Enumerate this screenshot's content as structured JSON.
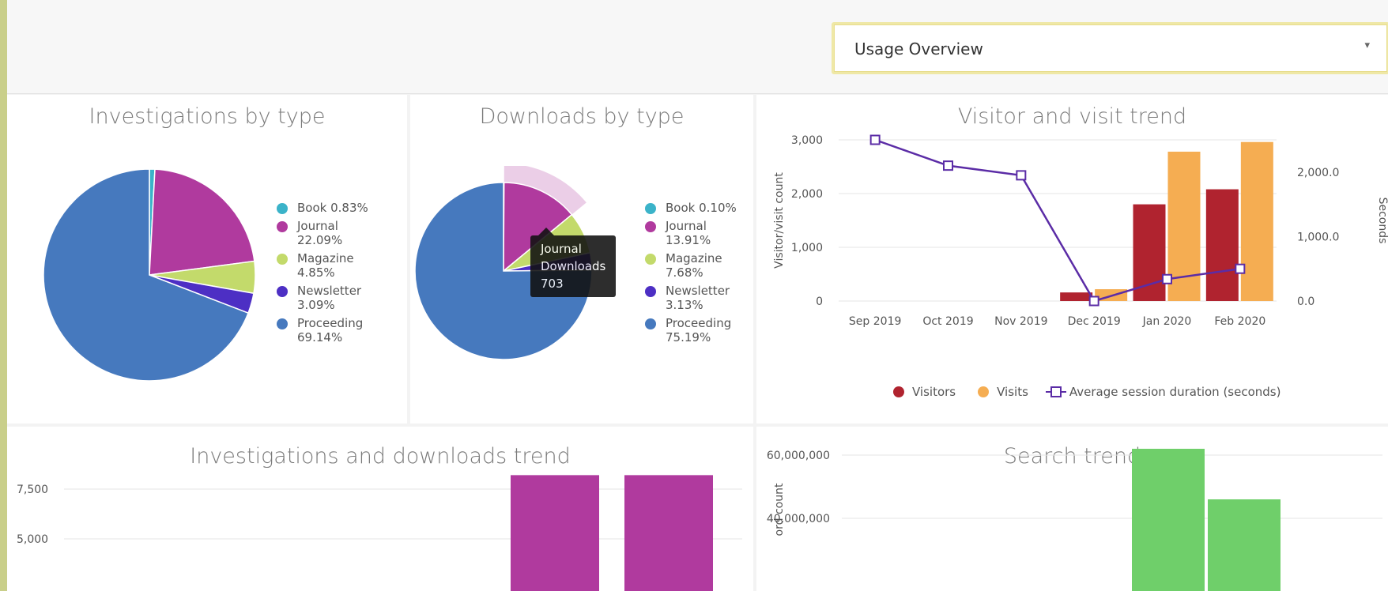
{
  "header": {
    "dropdown_value": "Usage Overview",
    "caret": "▾"
  },
  "charts": {
    "investigations_by_type": {
      "title": "Investigations by type"
    },
    "downloads_by_type": {
      "title": "Downloads by type"
    },
    "visitor_trend": {
      "title": "Visitor and visit trend",
      "ylabel_left": "Visitor/visit count",
      "ylabel_right": "Seconds"
    },
    "inv_dl_trend": {
      "title": "Investigations and downloads trend"
    },
    "search_trend": {
      "title": "Search trend",
      "ylabel": "ord count"
    }
  },
  "tooltip": {
    "line1": "Journal",
    "line2": "Downloads",
    "line3": "703"
  },
  "colors": {
    "book": "#3bb3c9",
    "journal": "#b03a9e",
    "magazine": "#c3da6b",
    "newsletter": "#4d2fc4",
    "proceeding": "#4679be",
    "visitors": "#b0232f",
    "visits": "#f5ad52",
    "session": "#5b2ca6",
    "purple_bar": "#b03a9e",
    "green_bar": "#6fcf6a"
  },
  "chart_data": [
    {
      "type": "pie",
      "title": "Investigations by type",
      "labels": [
        "Book",
        "Journal",
        "Magazine",
        "Newsletter",
        "Proceeding"
      ],
      "values": [
        0.83,
        22.09,
        4.85,
        3.09,
        69.14
      ],
      "value_labels": [
        "0.83%",
        "22.09%",
        "4.85%",
        "3.09%",
        "69.14%"
      ],
      "legend": "right"
    },
    {
      "type": "pie",
      "title": "Downloads by type",
      "labels": [
        "Book",
        "Journal",
        "Magazine",
        "Newsletter",
        "Proceeding"
      ],
      "values": [
        0.1,
        13.91,
        7.68,
        3.13,
        75.19
      ],
      "value_labels": [
        "0.10%",
        "13.91%",
        "7.68%",
        "3.13%",
        "75.19%"
      ],
      "highlighted": "Journal",
      "legend": "right"
    },
    {
      "type": "bar",
      "title": "Visitor and visit trend",
      "categories": [
        "Sep 2019",
        "Oct 2019",
        "Nov 2019",
        "Dec 2019",
        "Jan 2020",
        "Feb 2020"
      ],
      "series": [
        {
          "name": "Visitors",
          "kind": "bar",
          "values": [
            0,
            0,
            0,
            160,
            1800,
            2080
          ]
        },
        {
          "name": "Visits",
          "kind": "bar",
          "values": [
            0,
            0,
            0,
            220,
            2780,
            2960
          ]
        },
        {
          "name": "Average session duration (seconds)",
          "kind": "line",
          "axis": "right",
          "values": [
            2500,
            2100,
            1950,
            0,
            340,
            500
          ]
        }
      ],
      "ylabel": "Visitor/visit count",
      "ylim": [
        0,
        3000
      ],
      "yticks": [
        "0",
        "1,000",
        "2,000",
        "3,000"
      ],
      "y2label": "Seconds",
      "y2lim": [
        0,
        2500
      ],
      "y2ticks": [
        "0.0",
        "1,000.0",
        "2,000.0"
      ],
      "legend": "bottom"
    },
    {
      "type": "bar",
      "title": "Investigations and downloads trend",
      "yticks": [
        "5,000",
        "7,500"
      ],
      "series": [
        {
          "values": [
            8200,
            8200
          ]
        }
      ]
    },
    {
      "type": "bar",
      "title": "Search trend",
      "ylabel": "ord count",
      "yticks": [
        "40,000,000",
        "60,000,000"
      ],
      "series": [
        {
          "values": [
            62000000,
            46000000
          ]
        }
      ]
    }
  ]
}
